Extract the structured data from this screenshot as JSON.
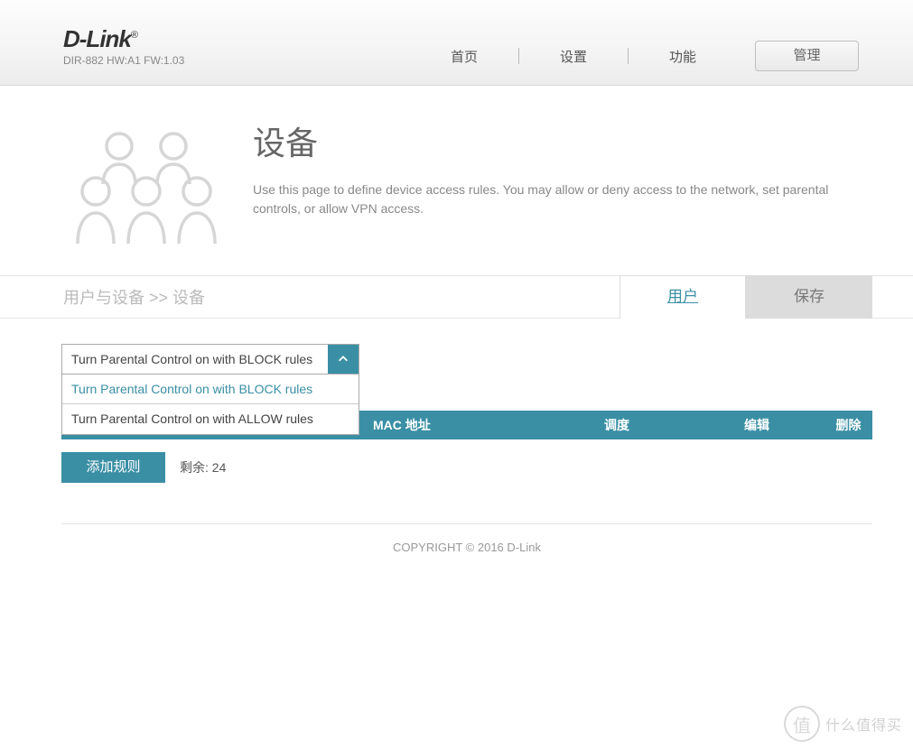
{
  "brand": {
    "name": "D-Link",
    "model": "DIR-882 HW:A1 FW:1.03"
  },
  "nav": {
    "home": "首页",
    "settings": "设置",
    "features": "功能",
    "manage": "管理"
  },
  "hero": {
    "title": "设备",
    "desc": "Use this page to define device access rules. You may allow or deny access to the network, set parental controls, or allow VPN access."
  },
  "crumb": {
    "path": "用户与设备 >> 设备",
    "tab_user": "用户",
    "tab_save": "保存"
  },
  "dropdown": {
    "selected": "Turn Parental Control on with BLOCK rules",
    "options": [
      "Turn Parental Control on with BLOCK rules",
      "Turn Parental Control on with ALLOW rules"
    ]
  },
  "table": {
    "col_mac": "MAC 地址",
    "col_sched": "调度",
    "col_edit": "编辑",
    "col_del": "删除"
  },
  "actions": {
    "add": "添加规则",
    "remain": "剩余: 24"
  },
  "footer": "COPYRIGHT © 2016 D-Link",
  "watermark": {
    "glyph": "值",
    "text": "什么值得买"
  }
}
